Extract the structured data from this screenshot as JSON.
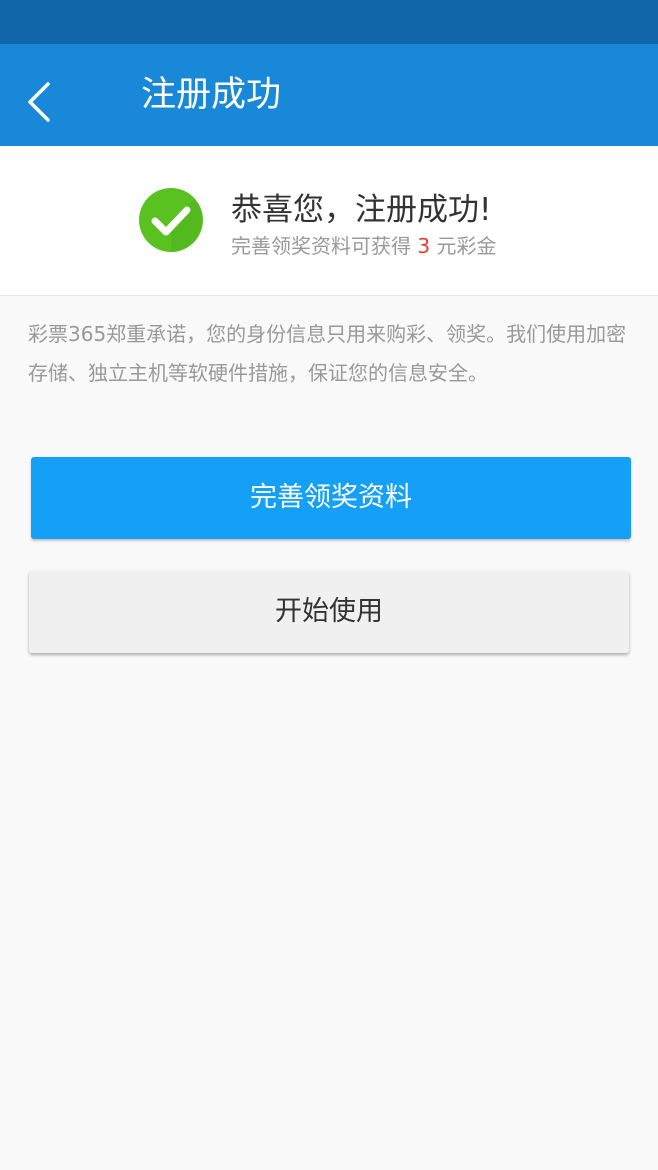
{
  "nav": {
    "title": "注册成功",
    "back_icon": "chevron-left-icon"
  },
  "success": {
    "icon": "check-circle-icon",
    "title": "恭喜您，注册成功!",
    "subtitle_prefix": "完善领奖资料可获得",
    "amount": "3",
    "subtitle_suffix": "元彩金"
  },
  "promise_text": "彩票365郑重承诺，您的身份信息只用来购彩、领奖。我们使用加密存储、独立主机等软硬件措施，保证您的信息安全。",
  "buttons": {
    "complete_profile": "完善领奖资料",
    "start_using": "开始使用"
  },
  "colors": {
    "status_bar": "#1166aa",
    "nav_bar": "#1a88d8",
    "primary_button": "#13a0f6",
    "secondary_button": "#f0f0f0",
    "check_green": "#59c221",
    "amount_red": "#f03a2e"
  }
}
